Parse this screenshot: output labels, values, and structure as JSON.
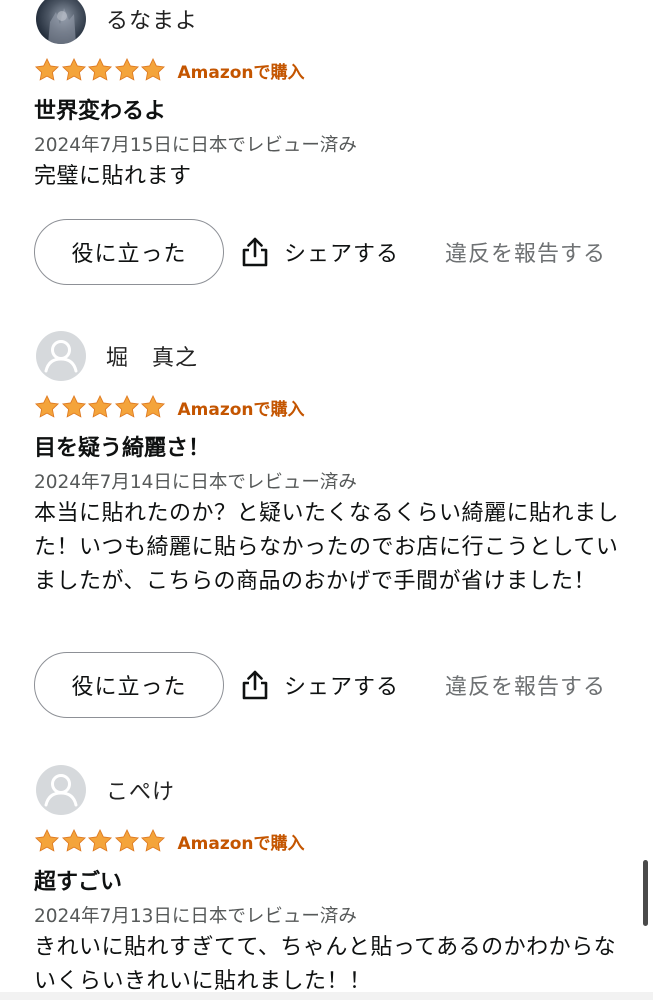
{
  "reviews": [
    {
      "reviewer": "るなまよ",
      "avatar_type": "photo",
      "rating": 5,
      "verified_label": "Amazonで購入",
      "title": "世界変わるよ",
      "date": "2024年7月15日に日本でレビュー済み",
      "body": "完璧に貼れます",
      "helpful_label": "役に立った",
      "share_label": "シェアする",
      "report_label": "違反を報告する"
    },
    {
      "reviewer": "堀　真之",
      "avatar_type": "default",
      "rating": 5,
      "verified_label": "Amazonで購入",
      "title": "目を疑う綺麗さ！",
      "date": "2024年7月14日に日本でレビュー済み",
      "body": "本当に貼れたのか？と疑いたくなるくらい綺麗に貼れました！いつも綺麗に貼らなかったのでお店に行こうとしていましたが、こちらの商品のおかげで手間が省けました！",
      "helpful_label": "役に立った",
      "share_label": "シェアする",
      "report_label": "違反を報告する"
    },
    {
      "reviewer": "こぺけ",
      "avatar_type": "default",
      "rating": 5,
      "verified_label": "Amazonで購入",
      "title": "超すごい",
      "date": "2024年7月13日に日本でレビュー済み",
      "body": "きれいに貼れすぎてて、ちゃんと貼ってあるのかわからないくらいきれいに貼れました！！"
    }
  ],
  "colors": {
    "star": "#f4a43b",
    "verified": "#c45500",
    "date": "#565959",
    "report": "#6e7173"
  }
}
